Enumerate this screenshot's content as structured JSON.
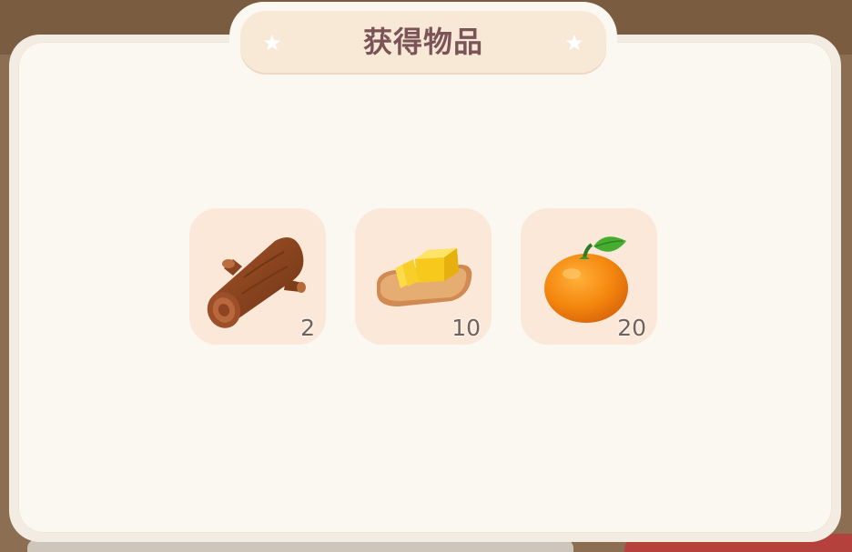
{
  "dialog": {
    "title": "获得物品"
  },
  "items": [
    {
      "icon": "wood-log-icon",
      "count": "2"
    },
    {
      "icon": "butter-icon",
      "count": "10"
    },
    {
      "icon": "orange-icon",
      "count": "20"
    }
  ],
  "colors": {
    "panel": "#fbf8f2",
    "title_plaque": "#f8e8d6",
    "title_text": "#7a5457",
    "slot": "#fbe8d8"
  }
}
